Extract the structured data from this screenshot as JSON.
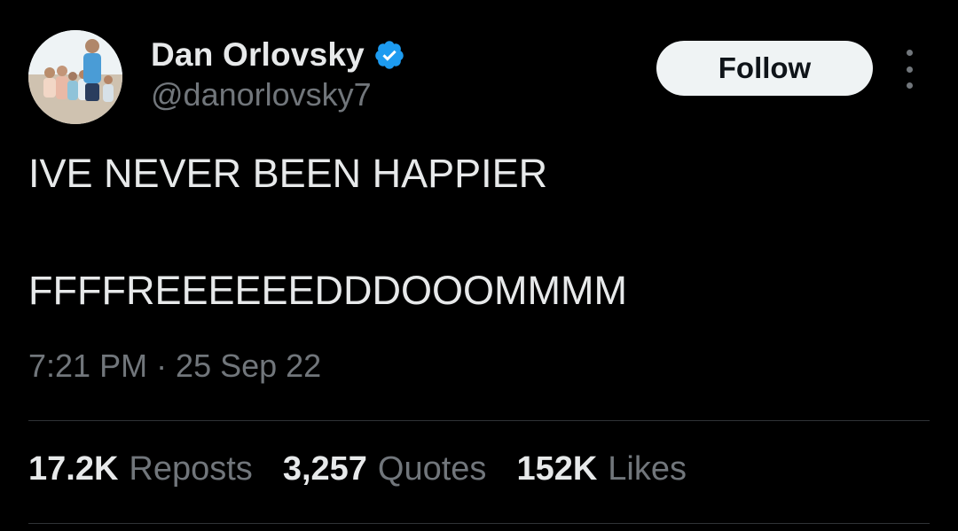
{
  "author": {
    "display_name": "Dan Orlovsky",
    "handle": "@danorlovsky7",
    "verified": true,
    "avatar_icon": "profile-photo-avatar"
  },
  "actions": {
    "follow_label": "Follow",
    "more_icon": "more-vertical-icon"
  },
  "tweet": {
    "lines": [
      "IVE NEVER BEEN HAPPIER",
      "FFFFREEEEEEDDDOOOMMMM"
    ],
    "timestamp": "7:21 PM · 25 Sep 22"
  },
  "stats": [
    {
      "count": "17.2K",
      "label": "Reposts"
    },
    {
      "count": "3,257",
      "label": "Quotes"
    },
    {
      "count": "152K",
      "label": "Likes"
    }
  ],
  "colors": {
    "background": "#000000",
    "primary_text": "#e7e9ea",
    "secondary_text": "#71767b",
    "verified_blue": "#1d9bf0",
    "follow_button_bg": "#eff3f4",
    "divider": "#2f3336"
  }
}
